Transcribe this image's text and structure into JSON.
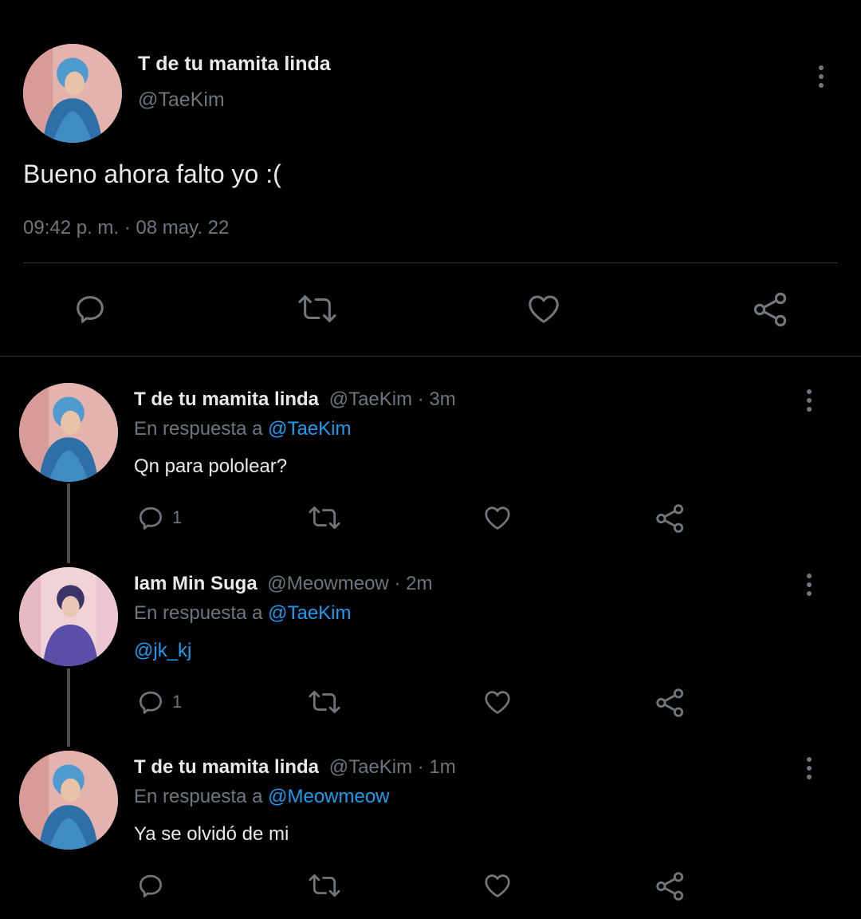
{
  "main_tweet": {
    "display_name": "T de tu mamita linda",
    "handle": "@TaeKim",
    "text": "Bueno ahora falto yo :(",
    "timestamp": "09:42 p. m. · 08 may. 22",
    "actions": [
      "reply-icon",
      "retweet-icon",
      "like-icon",
      "share-icon"
    ]
  },
  "replies": [
    {
      "display_name": "T de tu mamita linda",
      "handle": "@TaeKim",
      "time": "· 3m",
      "reply_prefix": "En respuesta a",
      "reply_to": "@TaeKim",
      "text": "Qn para pololear?",
      "reply_count": "1"
    },
    {
      "display_name": "Iam Min Suga",
      "handle": "@Meowmeow",
      "time": "· 2m",
      "reply_prefix": "En respuesta a",
      "reply_to": "@TaeKim",
      "text": "@jk_kj",
      "reply_count": "1"
    },
    {
      "display_name": "T de tu mamita linda",
      "handle": "@TaeKim",
      "time": "· 1m",
      "reply_prefix": "En respuesta a",
      "reply_to": "@Meowmeow",
      "text": "Ya se olvidó de mi",
      "reply_count": ""
    }
  ],
  "colors": {
    "background": "#000000",
    "text": "#e7e9ea",
    "muted": "#6e767d",
    "link": "#1d9bf0",
    "icon": "#71767b"
  }
}
